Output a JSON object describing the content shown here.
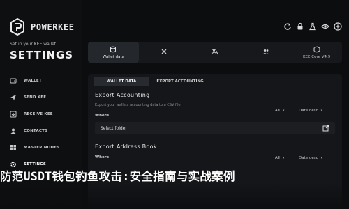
{
  "brand": {
    "name": "POWERKEE",
    "icon": "powerkee-logo-icon"
  },
  "sidebar": {
    "setup_text": "Setup your KEE wallet",
    "title": "SETTINGS",
    "items": [
      {
        "label": "WALLET",
        "icon": "wallet-icon"
      },
      {
        "label": "SEND KEE",
        "icon": "send-icon"
      },
      {
        "label": "RECEIVE KEE",
        "icon": "receive-icon"
      },
      {
        "label": "CONTACTS",
        "icon": "contacts-icon"
      },
      {
        "label": "MASTER NODES",
        "icon": "nodes-icon"
      },
      {
        "label": "SETTINGS",
        "icon": "gear-icon",
        "active": true
      }
    ]
  },
  "toolbar_icons": [
    "refresh-icon",
    "lock-icon",
    "flask-icon",
    "eye-icon",
    "plus-icon"
  ],
  "tabs": [
    {
      "label": "Wallet data",
      "icon": "database-icon",
      "active": true
    },
    {
      "label": "",
      "icon": "tools-icon"
    },
    {
      "label": "",
      "icon": "translate-icon"
    },
    {
      "label": "",
      "icon": "users-icon"
    },
    {
      "label": "KEE Core V4.9",
      "icon": "core-icon"
    }
  ],
  "subtabs": [
    {
      "label": "WALLET DATA",
      "active": true
    },
    {
      "label": "EXPORT ACCOUNTING",
      "active": false
    }
  ],
  "export_accounting": {
    "title": "Export Accounting",
    "description": "Export your wallets accounting data to a CSV file.",
    "where_label": "Where",
    "filter_value": "All",
    "sort_value": "Date desc",
    "folder_placeholder": "Select folder"
  },
  "export_address_book": {
    "title": "Export Address Book",
    "where_label": "Where",
    "filter_value": "All",
    "sort_value": "Date desc"
  },
  "headline": "防范USDT钱包钓鱼攻击:安全指南与实战案例"
}
